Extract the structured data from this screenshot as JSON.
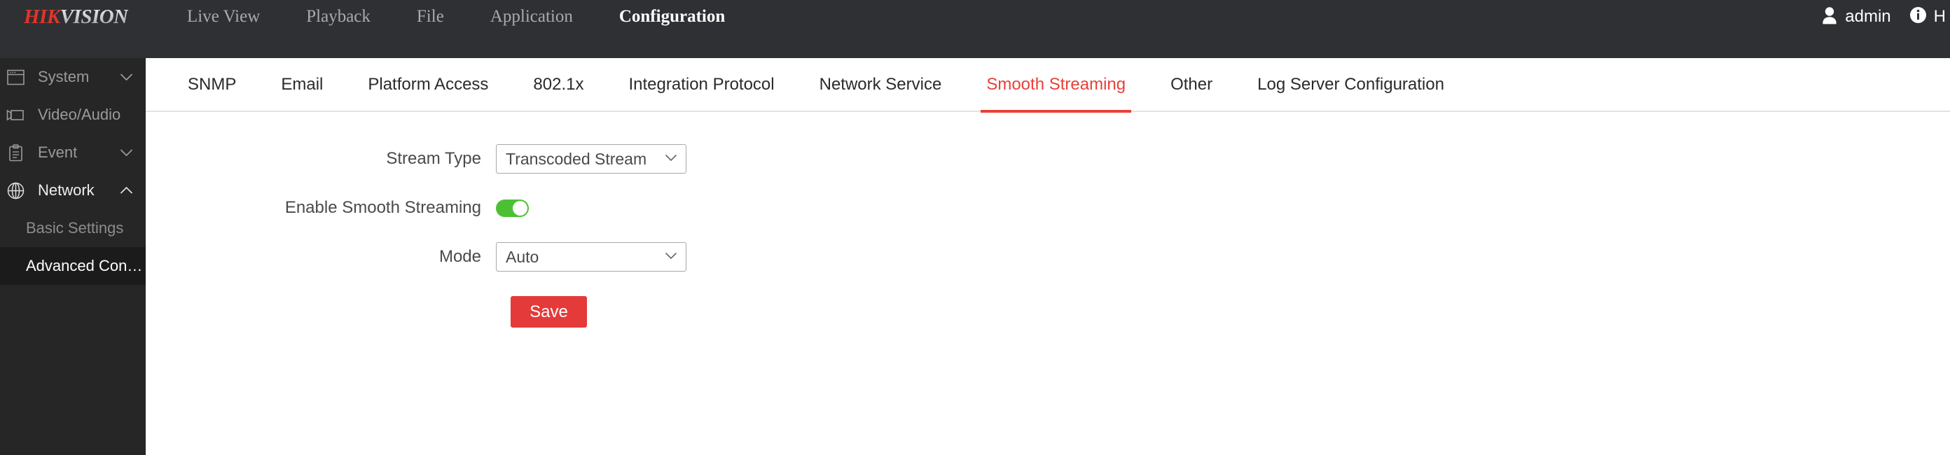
{
  "brand": {
    "part1": "HIK",
    "part2": "VISION"
  },
  "topnav": {
    "items": [
      {
        "label": "Live View",
        "active": false
      },
      {
        "label": "Playback",
        "active": false
      },
      {
        "label": "File",
        "active": false
      },
      {
        "label": "Application",
        "active": false
      },
      {
        "label": "Configuration",
        "active": true
      }
    ],
    "user": {
      "name": "admin",
      "icon": "person-icon"
    },
    "help": {
      "label": "H",
      "icon": "info-circle-icon"
    }
  },
  "sidebar": {
    "groups": [
      {
        "label": "System",
        "icon": "window-icon",
        "chevron": "chevron-down-icon",
        "active": false
      },
      {
        "label": "Video/Audio",
        "icon": "video-camera-icon",
        "chevron": "",
        "active": false
      },
      {
        "label": "Event",
        "icon": "clipboard-icon",
        "chevron": "chevron-down-icon",
        "active": false
      },
      {
        "label": "Network",
        "icon": "globe-icon",
        "chevron": "chevron-up-icon",
        "active": true
      }
    ],
    "subitems": [
      {
        "label": "Basic Settings",
        "selected": false
      },
      {
        "label": "Advanced Con…",
        "selected": true
      }
    ]
  },
  "tabs": [
    {
      "label": "SNMP",
      "active": false
    },
    {
      "label": "Email",
      "active": false
    },
    {
      "label": "Platform Access",
      "active": false
    },
    {
      "label": "802.1x",
      "active": false
    },
    {
      "label": "Integration Protocol",
      "active": false
    },
    {
      "label": "Network Service",
      "active": false
    },
    {
      "label": "Smooth Streaming",
      "active": true
    },
    {
      "label": "Other",
      "active": false
    },
    {
      "label": "Log Server Configuration",
      "active": false
    }
  ],
  "form": {
    "stream_type": {
      "label": "Stream Type",
      "value": "Transcoded Stream",
      "options": [
        "Transcoded Stream"
      ]
    },
    "enable_smooth_streaming": {
      "label": "Enable Smooth Streaming",
      "value": "on"
    },
    "mode": {
      "label": "Mode",
      "value": "Auto",
      "options": [
        "Auto"
      ]
    },
    "save_label": "Save"
  },
  "colors": {
    "brand_red": "#e2352b",
    "accent_red": "#e8413a",
    "save_red": "#e43a3a",
    "toggle_green": "#4cc034",
    "header_bg": "#2e3034",
    "sidebar_bg": "#262626",
    "sidebar_selected_bg": "#1b1b1b"
  }
}
